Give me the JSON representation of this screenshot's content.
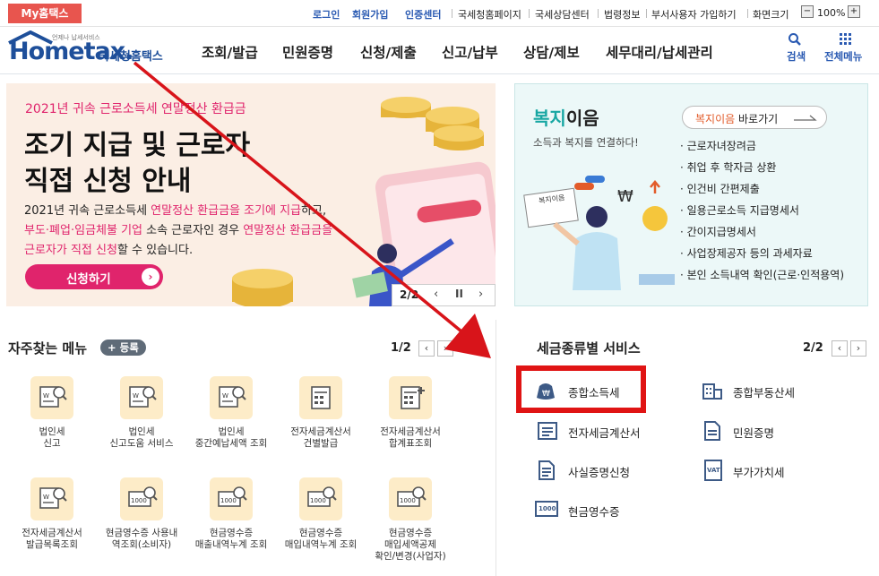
{
  "topbar": {
    "myhome": "My홈택스",
    "links": [
      "로그인",
      "회원가입",
      "인증센터",
      "국세청홈페이지",
      "국세상담센터",
      "법령정보",
      "부서사용자 가입하기",
      "화면크기"
    ],
    "zoom_minus": "−",
    "zoom_value": "100%",
    "zoom_plus": "+"
  },
  "header": {
    "logo_small": "언제나 납세서비스",
    "logo_text": "Hometax.",
    "logo_kor": "국세청홈택스",
    "nav": [
      "조회/발급",
      "민원증명",
      "신청/제출",
      "신고/납부",
      "상담/제보",
      "세무대리/납세관리"
    ],
    "search_label": "검색",
    "menu_label": "전체메뉴"
  },
  "banner": {
    "subtitle": "2021년 귀속 근로소득세 연말정산 환급금",
    "title_line1": "조기 지급 및 근로자",
    "title_line2": "직접 신청 안내",
    "desc_line1_a": "2021년 귀속 근로소득세 ",
    "desc_line1_b": "연말정산 환급금을 조기에 지급",
    "desc_line1_c": "하고,",
    "desc_line2_a": "부도·폐업·임금체불 기업",
    "desc_line2_b": " 소속 근로자인 경우 ",
    "desc_line2_c": "연말정산 환급금을",
    "desc_line3_a": "근로자가 직접 신청",
    "desc_line3_b": "할 수 있습니다.",
    "apply_button": "신청하기",
    "page": "2/2",
    "pause": "II"
  },
  "welfare": {
    "title_a": "복지",
    "title_b": "이음",
    "subtitle": "소득과 복지를 연결하다!",
    "shortcut_a": "복지이음",
    "shortcut_b": " 바로가기",
    "items": [
      "근로자녀장려금",
      "취업 후 학자금 상환",
      "인건비 간편제출",
      "일용근로소득 지급명세서",
      "간이지급명세서",
      "사업장제공자 등의 과세자료",
      "본인 소득내역 확인(근로·인적용역)"
    ],
    "illustration_text": "복지이음"
  },
  "faq": {
    "title": "자주찾는 메뉴",
    "register_button": "+ 등록",
    "page": "1/2",
    "items": [
      {
        "line1": "법인세",
        "line2": "신고",
        "icon": "document-search-icon"
      },
      {
        "line1": "법인세",
        "line2": "신고도움 서비스",
        "icon": "document-search-icon"
      },
      {
        "line1": "법인세",
        "line2": "중간예납세액 조회",
        "icon": "document-search-icon"
      },
      {
        "line1": "전자세금계산서",
        "line2": "건별발급",
        "icon": "calculator-icon"
      },
      {
        "line1": "전자세금계산서",
        "line2": "합계표조회",
        "icon": "calculator-plus-icon"
      },
      {
        "line1": "전자세금계산서",
        "line2": "발급목록조회",
        "icon": "document-search-icon"
      },
      {
        "line1": "현금영수증 사용내",
        "line2": "역조회(소비자)",
        "icon": "cash-search-icon"
      },
      {
        "line1": "현금영수증",
        "line2": "매출내역누계 조회",
        "icon": "cash-search-icon"
      },
      {
        "line1": "현금영수증",
        "line2": "매입내역누계 조회",
        "icon": "cash-search-icon"
      },
      {
        "line1": "현금영수증",
        "line2": "매입세액공제",
        "line3": "확인/변경(사업자)",
        "icon": "cash-search-icon"
      }
    ]
  },
  "services": {
    "title": "세금종류별 서비스",
    "page": "2/2",
    "items": [
      "종합소득세",
      "종합부동산세",
      "전자세금계산서",
      "민원증명",
      "사실증명신청",
      "부가가치세",
      "현금영수증"
    ],
    "cash_icon_text": "1000",
    "vat_icon_text": "VAT"
  },
  "colors": {
    "accent_red": "#e8554e",
    "brand_blue": "#1e4f9a",
    "pink": "#e0246c",
    "highlight_red": "#e01414"
  }
}
